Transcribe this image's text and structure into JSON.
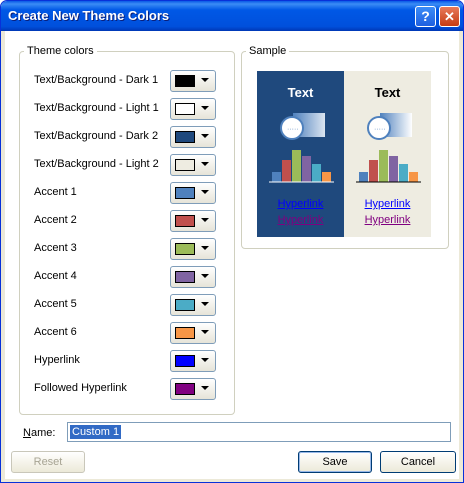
{
  "window": {
    "title": "Create New Theme Colors"
  },
  "theme_group": {
    "legend": "Theme colors",
    "rows": [
      {
        "label": "Text/Background - Dark 1",
        "color": "#000000"
      },
      {
        "label": "Text/Background - Light 1",
        "color": "#ffffff"
      },
      {
        "label": "Text/Background - Dark 2",
        "color": "#1f497d"
      },
      {
        "label": "Text/Background - Light 2",
        "color": "#eeece1"
      },
      {
        "label": "Accent 1",
        "color": "#4f81bd"
      },
      {
        "label": "Accent 2",
        "color": "#c0504d"
      },
      {
        "label": "Accent 3",
        "color": "#9bbb59"
      },
      {
        "label": "Accent 4",
        "color": "#8064a2"
      },
      {
        "label": "Accent 5",
        "color": "#4bacc6"
      },
      {
        "label": "Accent 6",
        "color": "#f79646"
      },
      {
        "label": "Hyperlink",
        "color": "#0000ff"
      },
      {
        "label": "Followed Hyperlink",
        "color": "#800080"
      }
    ]
  },
  "sample_group": {
    "legend": "Sample",
    "dark": {
      "text": "Text",
      "hyperlink": "Hyperlink",
      "followed": "Hyperlink",
      "background": "#1f497d"
    },
    "light": {
      "text": "Text",
      "hyperlink": "Hyperlink",
      "followed": "Hyperlink",
      "background": "#eeece1"
    }
  },
  "name": {
    "label": "Name:",
    "value": "Custom 1"
  },
  "buttons": {
    "reset": "Reset",
    "save": "Save",
    "cancel": "Cancel"
  },
  "colors": {
    "title_bar": "#0055e5"
  }
}
